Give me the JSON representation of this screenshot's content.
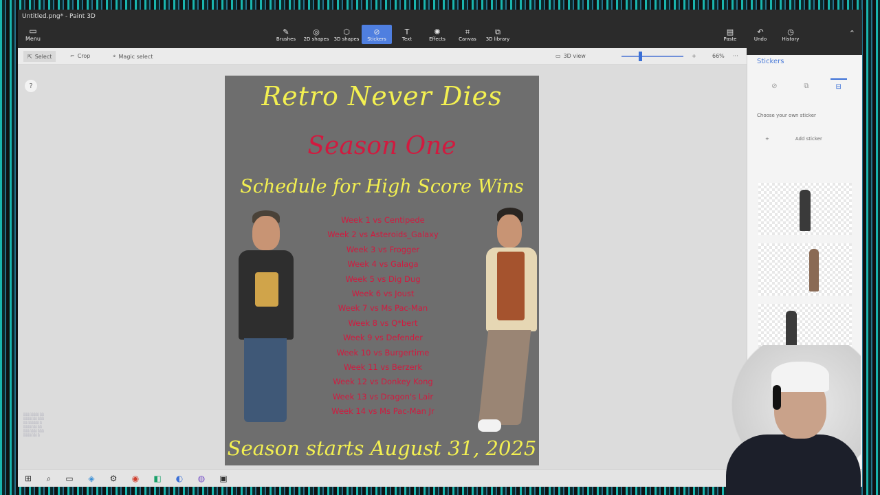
{
  "window": {
    "title": "Untitled.png* - Paint 3D"
  },
  "ribbon": {
    "menu_label": "Menu",
    "tools": [
      {
        "label": "Brushes",
        "icon": "brush-icon"
      },
      {
        "label": "2D shapes",
        "icon": "2d-shapes-icon"
      },
      {
        "label": "3D shapes",
        "icon": "3d-shapes-icon"
      },
      {
        "label": "Stickers",
        "icon": "stickers-icon",
        "active": true
      },
      {
        "label": "Text",
        "icon": "text-icon"
      },
      {
        "label": "Effects",
        "icon": "effects-icon"
      },
      {
        "label": "Canvas",
        "icon": "canvas-icon"
      },
      {
        "label": "3D library",
        "icon": "3d-library-icon"
      }
    ],
    "right_tools": [
      {
        "label": "Paste",
        "icon": "paste-icon"
      },
      {
        "label": "Undo",
        "icon": "undo-icon"
      },
      {
        "label": "History",
        "icon": "history-icon"
      }
    ]
  },
  "subbar": {
    "select_label": "Select",
    "crop_label": "Crop",
    "magic_select_label": "Magic select",
    "view_3d_label": "3D view",
    "zoom_percent": "66%",
    "more_label": "···"
  },
  "poster": {
    "title": "Retro Never Dies",
    "season": "Season One",
    "schedule": "Schedule for High Score Wins",
    "weeks": [
      "Week 1 vs Centipede",
      "Week 2 vs Asteroids_Galaxy",
      "Week 3 vs Frogger",
      "Week 4 vs Galaga",
      "Week 5 vs Dig Dug",
      "Week 6 vs Joust",
      "Week 7 vs Ms Pac-Man",
      "Week 8 vs Q*bert",
      "Week 9 vs Defender",
      "Week 10 vs Burgertime",
      "Week 11 vs Berzerk",
      "Week 12 vs Donkey Kong",
      "Week 13 vs Dragon's Lair",
      "Week 14 vs Ms Pac-Man Jr"
    ],
    "start": "Season starts August 31, 2025"
  },
  "panel": {
    "header": "Stickers",
    "choose_label": "Choose your own sticker",
    "add_label": "Add sticker",
    "tabs": [
      "sticker-icon",
      "shapes-icon",
      "custom-icon"
    ]
  },
  "help_label": "?",
  "colors": {
    "poster_bg": "#6e6e6e",
    "yellow_text": "#f3f051",
    "red_text": "#d11a3f",
    "accent": "#4f7fe0"
  }
}
